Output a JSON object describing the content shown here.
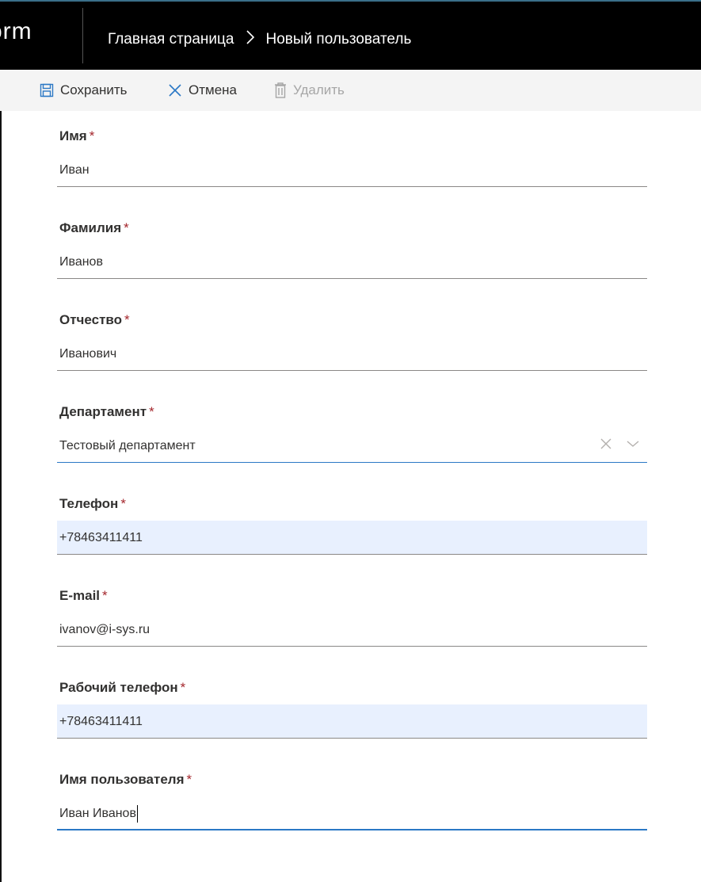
{
  "header": {
    "brand": "orm",
    "breadcrumbs": [
      "Главная страница",
      "Новый пользователь"
    ]
  },
  "toolbar": {
    "save_label": "Сохранить",
    "cancel_label": "Отмена",
    "delete_label": "Удалить"
  },
  "form": {
    "required_marker": "*",
    "fields": [
      {
        "label": "Имя",
        "value": "Иван"
      },
      {
        "label": "Фамилия",
        "value": "Иванов"
      },
      {
        "label": "Отчество",
        "value": "Иванович"
      },
      {
        "label": "Департамент",
        "value": "Тестовый департамент"
      },
      {
        "label": "Телефон",
        "value": "+78463411411"
      },
      {
        "label": "E-mail",
        "value": "ivanov@i-sys.ru"
      },
      {
        "label": "Рабочий телефон",
        "value": "+78463411411"
      },
      {
        "label": "Имя пользователя",
        "value": "Иван Иванов"
      }
    ]
  },
  "colors": {
    "header_bg": "#000000",
    "required": "#a4262c",
    "autofill_bg": "#e8f0fe",
    "focus_underline": "#2b78c5"
  }
}
